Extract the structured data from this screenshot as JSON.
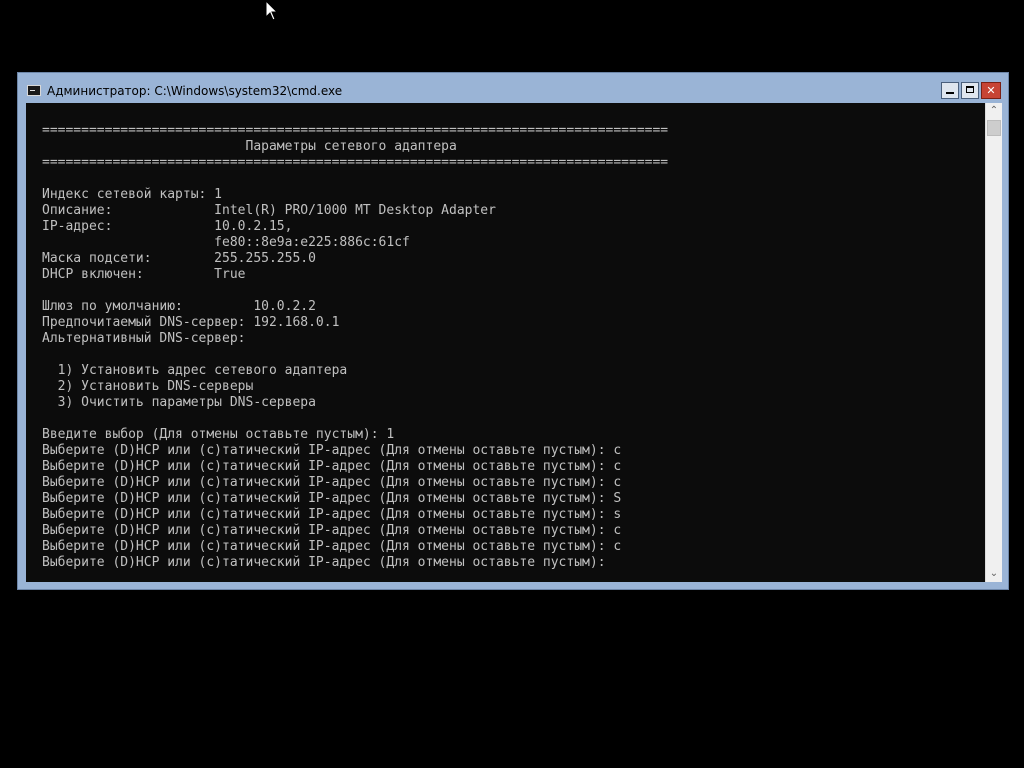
{
  "window": {
    "title": "Администратор: C:\\Windows\\system32\\cmd.exe",
    "minimize_label": "",
    "maximize_label": "",
    "close_label": "✕"
  },
  "console": {
    "lines": [
      "================================================================================",
      "                          Параметры сетевого адаптера",
      "================================================================================",
      "",
      "Индекс сетевой карты: 1",
      "Описание:             Intel(R) PRO/1000 MT Desktop Adapter",
      "IP-адрес:             10.0.2.15,",
      "                      fe80::8e9a:e225:886c:61cf",
      "Маска подсети:        255.255.255.0",
      "DHCP включен:         True",
      "",
      "Шлюз по умолчанию:         10.0.2.2",
      "Предпочитаемый DNS-сервер: 192.168.0.1",
      "Альтернативный DNS-сервер:",
      "",
      "  1) Установить адрес сетевого адаптера",
      "  2) Установить DNS-серверы",
      "  3) Очистить параметры DNS-сервера",
      "",
      "Введите выбор (Для отмены оставьте пустым): 1",
      "Выберите (D)HCP или (с)татический IP-адрес (Для отмены оставьте пустым): с",
      "Выберите (D)HCP или (с)татический IP-адрес (Для отмены оставьте пустым): с",
      "Выберите (D)HCP или (с)татический IP-адрес (Для отмены оставьте пустым): с",
      "Выберите (D)HCP или (с)татический IP-адрес (Для отмены оставьте пустым): S",
      "Выберите (D)HCP или (с)татический IP-адрес (Для отмены оставьте пустым): s",
      "Выберите (D)HCP или (с)татический IP-адрес (Для отмены оставьте пустым): с",
      "Выберите (D)HCP или (с)татический IP-адрес (Для отмены оставьте пустым): с",
      "Выберите (D)HCP или (с)татический IP-адрес (Для отмены оставьте пустым):"
    ]
  },
  "scrollbar": {
    "up_icon": "chevron-up-icon",
    "down_icon": "chevron-down-icon"
  },
  "colors": {
    "desktop": "#000000",
    "window_frame": "#9ab4d6",
    "console_bg": "#0c0c0c",
    "console_text": "#c0c0c0",
    "close_button": "#c74434"
  }
}
